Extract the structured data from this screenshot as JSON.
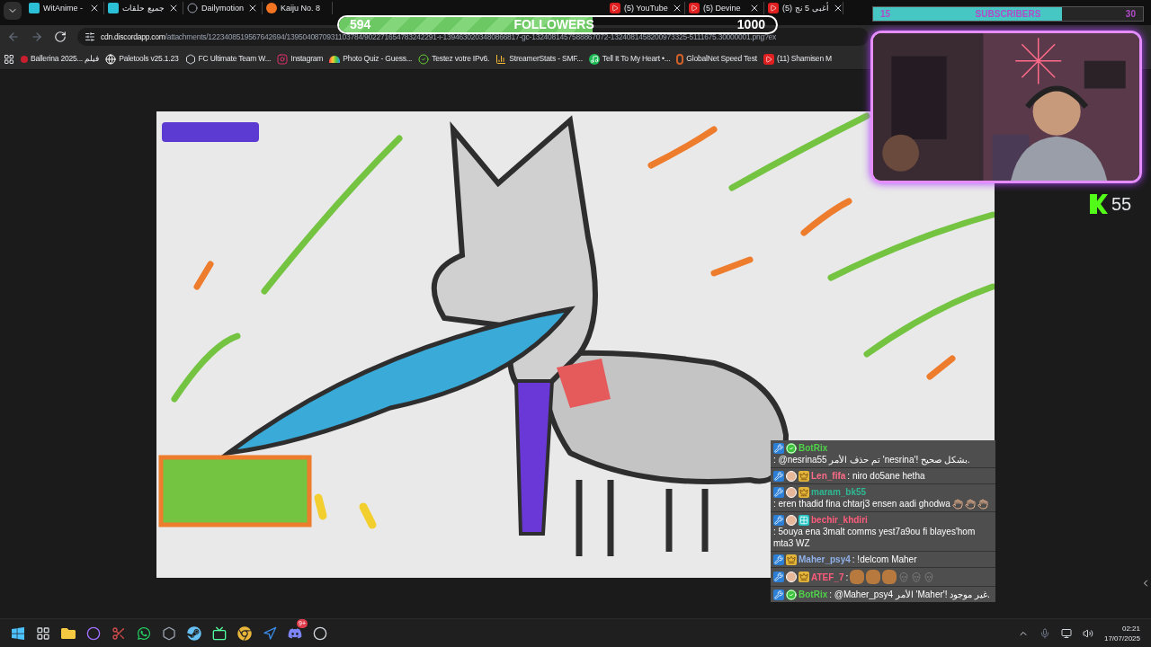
{
  "browser": {
    "tabs": [
      {
        "title": "WitAnime - ",
        "kind": "witanime"
      },
      {
        "title": "جميع حلقات",
        "kind": "witanime"
      },
      {
        "title": "Dailymotion",
        "kind": "dailymotion"
      },
      {
        "title": "Kaiju No. 8",
        "kind": "crunchyroll"
      },
      {
        "title": "(5) YouTube",
        "kind": "youtube"
      },
      {
        "title": "(5) Devine",
        "kind": "youtube"
      },
      {
        "title": "(5) أغبى 5 نج",
        "kind": "youtube"
      }
    ],
    "url_host": "cdn.discordapp.com",
    "url_path": "/attachments/1223408519567642694/1395040870931103784/902271654783242291-i-1394630203480866817-gc-1324081457588867072-1324081458200973325-5111675.30000001.png?ex",
    "bookmarks": [
      {
        "label": "Ballerina 2025... فيلم",
        "kind": "dot"
      },
      {
        "label": "Paletools v25.1.23",
        "kind": "globe"
      },
      {
        "label": "FC Ultimate Team W...",
        "kind": "badge"
      },
      {
        "label": "Instagram",
        "kind": "camera"
      },
      {
        "label": "Photo Quiz - Guess...",
        "kind": "rainbow"
      },
      {
        "label": "Testez votre IPv6.",
        "kind": "check"
      },
      {
        "label": "StreamerStats - SMF...",
        "kind": "bars"
      },
      {
        "label": "Tell It To My Heart •...",
        "kind": "music"
      },
      {
        "label": "GlobalNet Speed Test",
        "kind": "g"
      },
      {
        "label": "(11) Shamisen M",
        "kind": "youtube"
      }
    ]
  },
  "followers": {
    "current": "594",
    "label": "FOLLOWERS",
    "goal": "1000",
    "level": 0.58
  },
  "subscribers": {
    "current": "15",
    "label": "SUBSCRIBERS",
    "goal": "30",
    "level": 0.7
  },
  "kick": {
    "count": "55"
  },
  "chat": [
    {
      "user": "BotRix",
      "color": "#4fd14a",
      "badges": [
        {
          "kind": "mod"
        },
        {
          "kind": "verified"
        }
      ],
      "text": ": @nesrina55 تم حذف الأمر 'nesrina'! بشكل صحيح."
    },
    {
      "user": "Len_fifa",
      "color": "#ff6b88",
      "badges": [
        {
          "kind": "mod"
        },
        {
          "kind": "avatar"
        },
        {
          "kind": "crown"
        }
      ],
      "text": ": niro do5ane hetha"
    },
    {
      "user": "maram_bk55",
      "color": "#2fb893",
      "badges": [
        {
          "kind": "mod"
        },
        {
          "kind": "avatar"
        },
        {
          "kind": "crown"
        }
      ],
      "text": ": eren thadid fina chtarj3 ensen aadi ghodwa",
      "emotes": [
        {
          "kind": "hand"
        },
        {
          "kind": "hand"
        },
        {
          "kind": "hand"
        }
      ]
    },
    {
      "user": "bechir_khdiri",
      "color": "#ff5c7c",
      "badges": [
        {
          "kind": "mod"
        },
        {
          "kind": "avatar"
        },
        {
          "kind": "grid"
        }
      ],
      "text": ": 5ouya ena 3malt comms yest7a9ou fi blayes'hom mta3 WZ"
    },
    {
      "user": "Maher_psy4",
      "color": "#8fb0e8",
      "badges": [
        {
          "kind": "mod"
        },
        {
          "kind": "crown"
        }
      ],
      "text": ": !delcom Maher"
    },
    {
      "user": "ATEF_7",
      "color": "#ff5c7c",
      "badges": [
        {
          "kind": "mod"
        },
        {
          "kind": "avatar"
        },
        {
          "kind": "crown"
        }
      ],
      "text": ":",
      "emotes": [
        {
          "kind": "face"
        },
        {
          "kind": "face"
        },
        {
          "kind": "face"
        },
        {
          "kind": "skull"
        },
        {
          "kind": "skull"
        },
        {
          "kind": "skull"
        }
      ]
    },
    {
      "user": "BotRix",
      "color": "#4fd14a",
      "badges": [
        {
          "kind": "mod"
        },
        {
          "kind": "verified"
        }
      ],
      "text": ": @Maher_psy4 الأمر 'Maher'! غير موجود."
    }
  ],
  "taskbar": {
    "discord_badge": "9+",
    "time": "02:21",
    "date": "17/07/2025"
  }
}
